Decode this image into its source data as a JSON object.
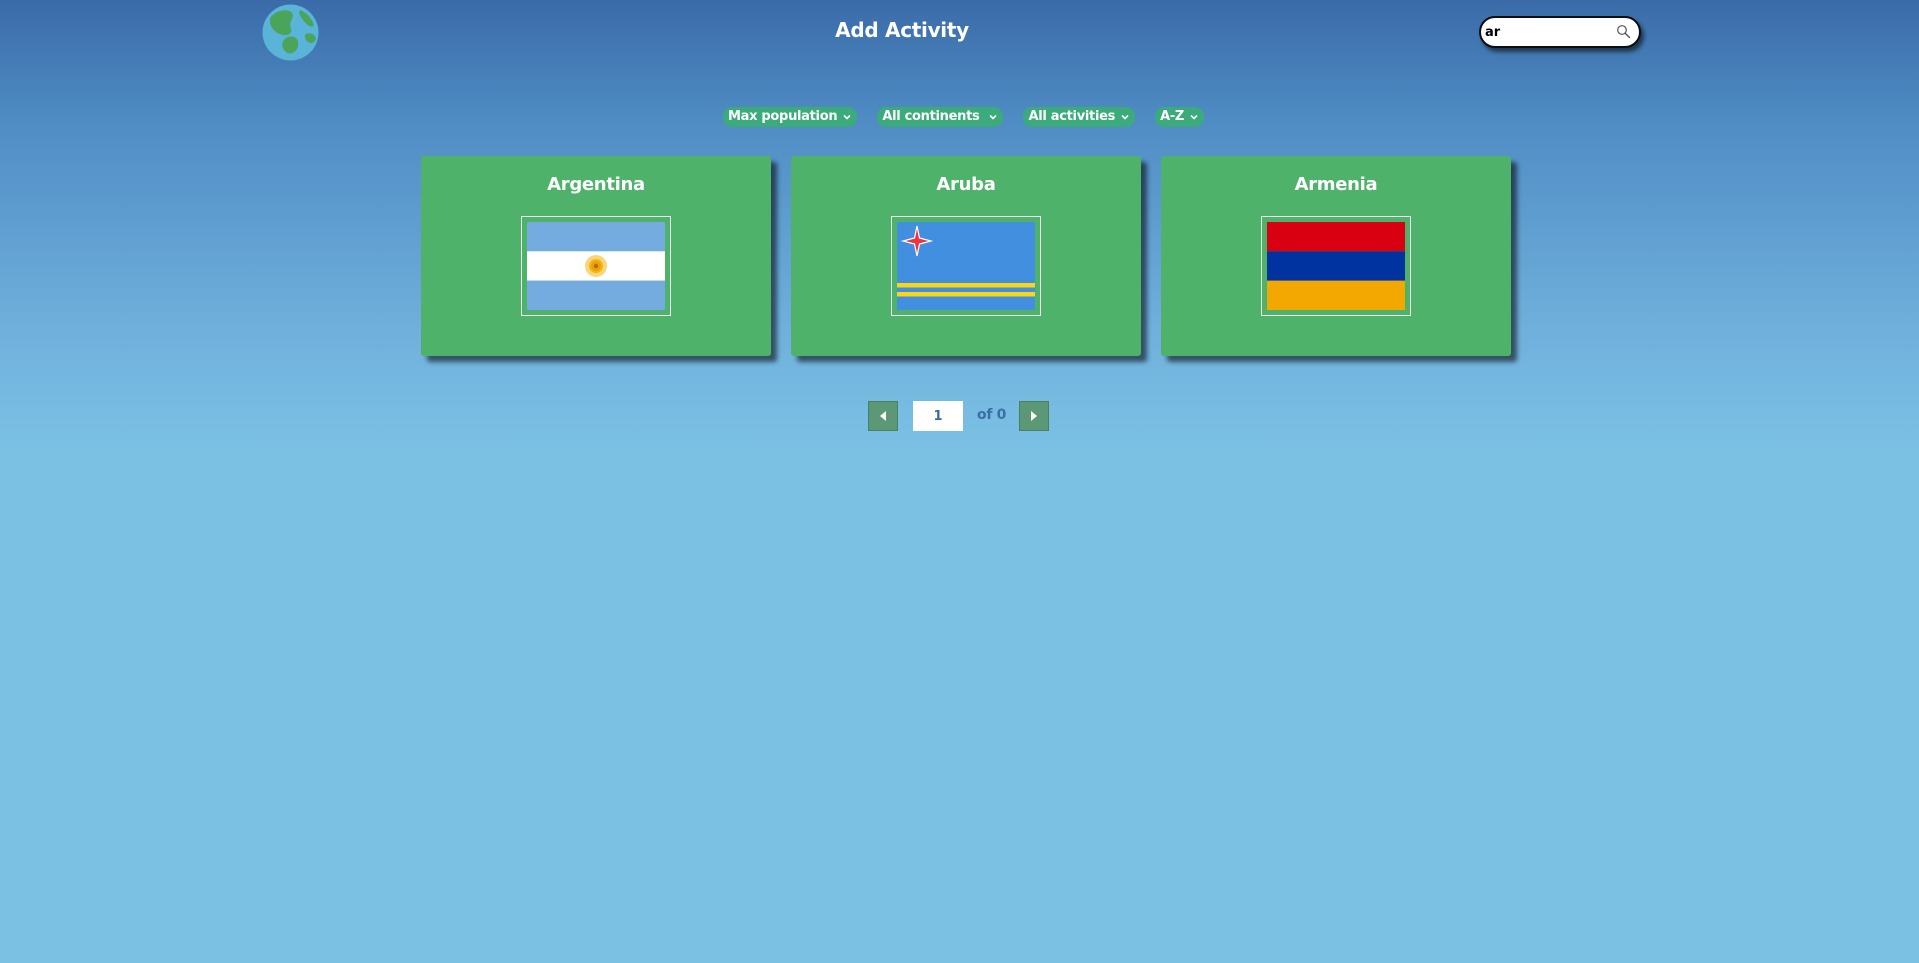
{
  "header": {
    "title": "Add Activity",
    "logo_icon": "globe-icon",
    "search": {
      "value": "ar",
      "placeholder": "",
      "icon": "search-icon"
    }
  },
  "filters": [
    {
      "label": "Max population"
    },
    {
      "label": "All continents"
    },
    {
      "label": "All activities"
    },
    {
      "label": "A-Z"
    }
  ],
  "countries": [
    {
      "name": "Argentina",
      "flag_icon": "argentina-flag"
    },
    {
      "name": "Aruba",
      "flag_icon": "aruba-flag"
    },
    {
      "name": "Armenia",
      "flag_icon": "armenia-flag"
    }
  ],
  "pagination": {
    "current_page": "1",
    "total_text": "of 0",
    "prev_icon": "triangle-left-icon",
    "next_icon": "triangle-right-icon"
  },
  "colors": {
    "card_bg": "#4fb26a",
    "filter_bg": "#3bab7b",
    "pager_bg": "#5d9876",
    "page_bg_top": "#3a6ba8",
    "page_bg_bottom": "#7bc1e4"
  }
}
